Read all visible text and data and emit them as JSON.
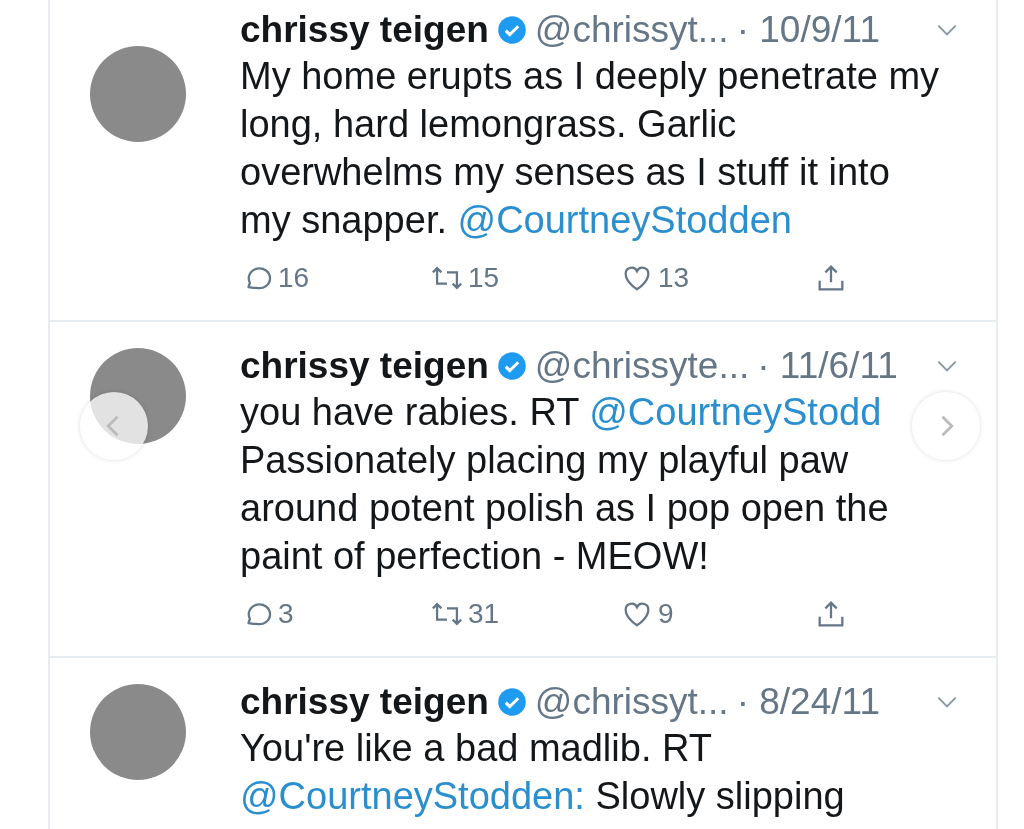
{
  "tweets": [
    {
      "name": "chrissy teigen",
      "handle": "@chrissyt...",
      "date": "· 10/9/11",
      "verified": true,
      "body": [
        {
          "kind": "text",
          "text": "My home erupts as I deeply penetrate my long, hard lemongrass. Garlic overwhelms my senses as I stuff it into my snapper. "
        },
        {
          "kind": "mention",
          "text": "@CourtneyStodden"
        }
      ],
      "stats": {
        "replies": "16",
        "retweets": "15",
        "likes": "13"
      }
    },
    {
      "name": "chrissy teigen",
      "handle": "@chrissyte...",
      "date": "· 11/6/11",
      "verified": true,
      "body": [
        {
          "kind": "text",
          "text": "you have rabies. RT "
        },
        {
          "kind": "mention",
          "text": "@CourtneyStodd"
        },
        {
          "kind": "text",
          "text": " Passionately placing my playful paw around potent polish as I pop open the paint of perfection - MEOW!"
        }
      ],
      "stats": {
        "replies": "3",
        "retweets": "31",
        "likes": "9"
      },
      "carousel": true
    },
    {
      "name": "chrissy teigen",
      "handle": "@chrissyt...",
      "date": "· 8/24/11",
      "verified": true,
      "body": [
        {
          "kind": "text",
          "text": "You're like a bad madlib. RT "
        },
        {
          "kind": "mention",
          "text": "@CourtneyStodden:"
        },
        {
          "kind": "text",
          "text": " Slowly slipping"
        }
      ]
    }
  ]
}
